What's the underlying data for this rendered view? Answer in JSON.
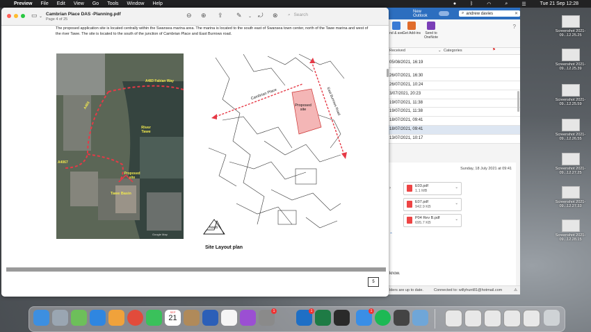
{
  "menubar": {
    "app": "Preview",
    "items": [
      "File",
      "Edit",
      "View",
      "Go",
      "Tools",
      "Window",
      "Help"
    ],
    "clock": "Tue 21 Sep  12:28"
  },
  "preview": {
    "title": "Cambrian Place DAS -Planning.pdf",
    "page_indicator": "Page 4 of 25",
    "search_placeholder": "Search",
    "intro_text": "The proposed application site is located centrally within the Swansea marina area.  The marina is located to the south east of  Swansea town center, north of the Tawe marina and west of the river Tawe.  The site is located to the south of the junction of Cambrian Place and East Burrows road.",
    "aerial_labels": {
      "road1": "A483 Fabian Way",
      "road2": "A483",
      "road3": "A4067",
      "river": "River Tawe",
      "site": "Proposed site",
      "basin": "Tawe Basin",
      "credit": "Google Map"
    },
    "plan_labels": {
      "street1": "Cambrian Place",
      "street2": "East Burrows Road",
      "site": "Proposed site",
      "north": "North"
    },
    "plan_caption": "Site Layout plan",
    "page_number": "5"
  },
  "outlook": {
    "new_outlook_label": "New Outlook",
    "search_value": "andrew davies",
    "ribbon": [
      {
        "label": "nd & ave",
        "color": "#3a7bd5"
      },
      {
        "label": "Get Add-ins",
        "color": "#e06c2b"
      },
      {
        "label": "Send to OneNote",
        "color": "#7b3fb7"
      }
    ],
    "col_received": "Received",
    "col_categories": "Categories",
    "rows": [
      "05/08/2021, 16:19",
      "26/07/2021, 16:30",
      "26/07/2021, 10:24",
      "3/07/2021, 20:23",
      "19/07/2021, 11:38",
      "19/07/2021, 11:38",
      "18/07/2021, 09:41",
      "18/07/2021, 09:41",
      "13/07/2021, 10:17"
    ],
    "selected_row_index": 7,
    "reading_date": "Sunday, 18 July 2021 at 09:41",
    "attachments": [
      {
        "name": "E03.pdf",
        "size": "1.1 MB"
      },
      {
        "name": "E07.pdf",
        "size": "942.9 KB"
      },
      {
        "name": "P04 Rev B.pdf",
        "size": "695.7 KB"
      }
    ],
    "body_fragment": "know.",
    "status_left": "lders are up to date.",
    "status_right": "Connected to: willyhunt81@hotmail.com"
  },
  "desktop_files": [
    {
      "name": "Screenshot 2021-09...12.25.25"
    },
    {
      "name": "Screenshot 2021-09...12.25.39"
    },
    {
      "name": "Screenshot 2021-09...12.25.59"
    },
    {
      "name": "Screenshot 2021-09...12.26.55"
    },
    {
      "name": "Screenshot 2021-09...12.27.25"
    },
    {
      "name": "Screenshot 2021-09...12.27.33"
    },
    {
      "name": "Screenshot 2021-09...12.28.15"
    }
  ],
  "dock": {
    "calendar_month": "SEP",
    "calendar_day": "21",
    "apps": [
      {
        "name": "finder",
        "color": "#3d8fe0"
      },
      {
        "name": "launchpad",
        "color": "#9aa6b2"
      },
      {
        "name": "maps",
        "color": "#6dbf5a"
      },
      {
        "name": "safari",
        "color": "#2f86e0"
      },
      {
        "name": "photos",
        "color": "#f0a23b"
      },
      {
        "name": "chrome",
        "color": "#e24b3b"
      },
      {
        "name": "facetime",
        "color": "#3ac15b"
      },
      {
        "name": "calendar",
        "color": "#ffffff"
      },
      {
        "name": "contacts",
        "color": "#b08a5a"
      },
      {
        "name": "word",
        "color": "#2b5fb8"
      },
      {
        "name": "reminders",
        "color": "#f5f5f5"
      },
      {
        "name": "podcasts",
        "color": "#9b4fd3"
      },
      {
        "name": "system-preferences",
        "color": "#8a8a8a"
      },
      {
        "name": "outlook",
        "color": "#1f6fc5"
      },
      {
        "name": "excel",
        "color": "#1e7b45"
      },
      {
        "name": "stocks",
        "color": "#2a2a2a"
      },
      {
        "name": "mail",
        "color": "#3a8ee6"
      },
      {
        "name": "spotify",
        "color": "#1db954"
      },
      {
        "name": "screen",
        "color": "#444444"
      },
      {
        "name": "preview",
        "color": "#6fa6d8"
      }
    ],
    "badges": {
      "system-preferences": "1",
      "outlook": "1",
      "mail": "1"
    }
  }
}
